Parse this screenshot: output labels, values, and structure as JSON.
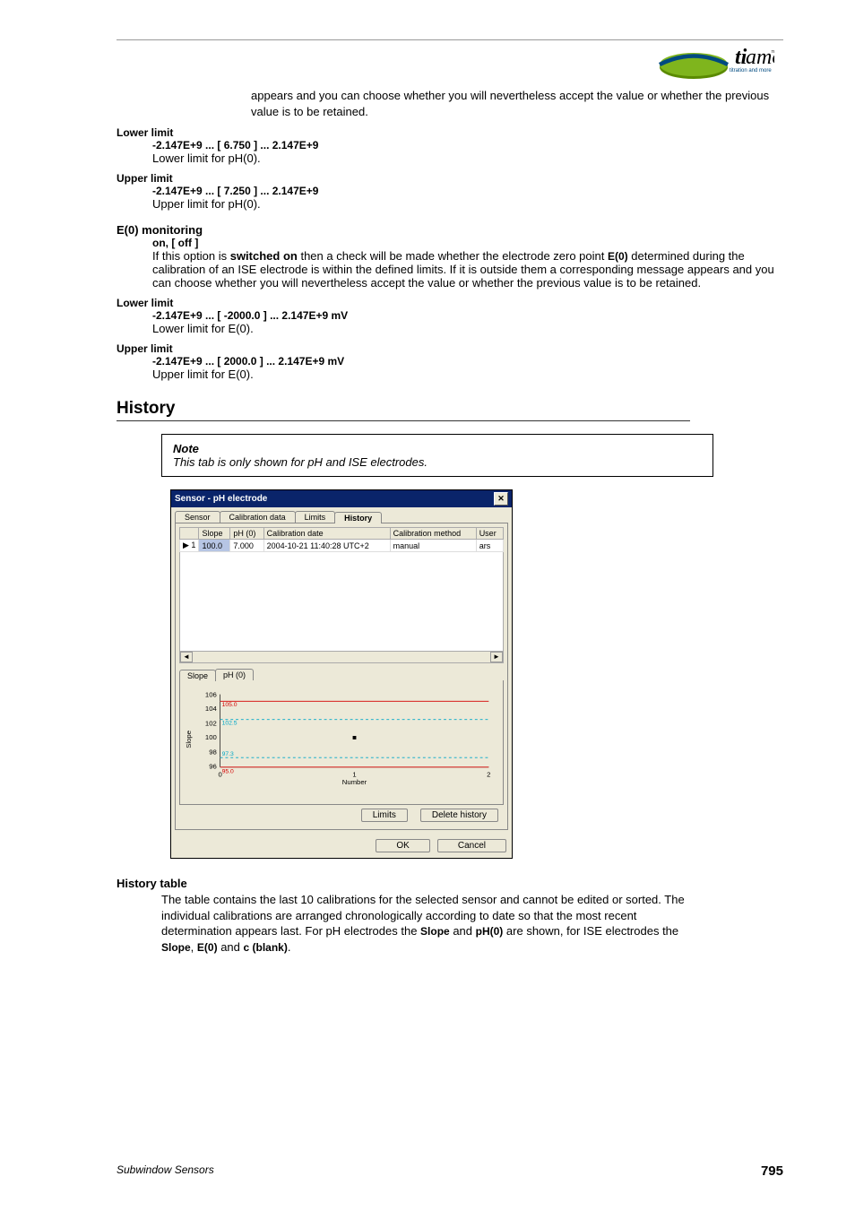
{
  "logo": {
    "brand": "tiamo",
    "tm": "™",
    "tagline": "titration and more"
  },
  "intro_cont": "appears and you can choose whether you will nevertheless accept the value or whether the previous value is to be retained.",
  "ph0": {
    "lower": {
      "label": "Lower limit",
      "range": "-2.147E+9 ... [ 6.750 ] ... 2.147E+9",
      "desc": "Lower limit for pH(0)."
    },
    "upper": {
      "label": "Upper limit",
      "range": "-2.147E+9 ... [ 7.250 ] ... 2.147E+9",
      "desc": "Upper limit for pH(0)."
    }
  },
  "e0": {
    "heading": "E(0) monitoring",
    "options": "on, [ off ]",
    "desc1": "If this option is ",
    "desc_bold": "switched on",
    "desc2": " then a check will be made whether the electrode zero point ",
    "desc_bold2": "E(0)",
    "desc3": " determined during the calibration of an ISE electrode is within the defined limits. If it is outside them a corresponding message appears and you can choose whether you will nevertheless accept the value or whether the previous value is to be retained.",
    "lower": {
      "label": "Lower limit",
      "range": "-2.147E+9 ... [ -2000.0 ] ... 2.147E+9 mV",
      "desc": "Lower limit for E(0)."
    },
    "upper": {
      "label": "Upper limit",
      "range": "-2.147E+9 ... [ 2000.0 ] ... 2.147E+9 mV",
      "desc": "Upper limit for E(0)."
    }
  },
  "history": {
    "heading": "History",
    "note_label": "Note",
    "note_text": "This tab is only shown for pH and ISE electrodes.",
    "table_heading": "History table",
    "para_a": "The table contains the last 10 calibrations for the selected sensor and cannot be edited or sorted. The individual calibrations are arranged chronologically according to date so that the most recent determination appears last. For pH electrodes the ",
    "b1": "Slope",
    "sep1": " and ",
    "b2": "pH(0)",
    "para_b": " are shown, for ISE electrodes the ",
    "b3": "Slope",
    "sep2": ", ",
    "b4": "E(0)",
    "sep3": " and ",
    "b5": "c (blank)",
    "para_c": "."
  },
  "dialog": {
    "title": "Sensor - pH electrode",
    "tabs": [
      "Sensor",
      "Calibration data",
      "Limits",
      "History"
    ],
    "active_tab": "History",
    "cols": [
      "",
      "Slope",
      "pH (0)",
      "Calibration date",
      "Calibration method",
      "User"
    ],
    "row": {
      "idx": "1",
      "slope": "100.0",
      "ph0": "7.000",
      "date": "2004-10-21 11:40:28 UTC+2",
      "method": "manual",
      "user": "ars"
    },
    "subtabs": [
      "Slope",
      "pH (0)"
    ],
    "buttons": {
      "limits": "Limits",
      "delete": "Delete history",
      "ok": "OK",
      "cancel": "Cancel"
    }
  },
  "chart_data": {
    "type": "scatter",
    "title": "",
    "xlabel": "Number",
    "ylabel": "Slope",
    "xlim": [
      0,
      2
    ],
    "ylim": [
      96,
      106
    ],
    "yticks": [
      96,
      98,
      100,
      102,
      104,
      106
    ],
    "xticks": [
      0,
      1,
      2
    ],
    "series": [
      {
        "name": "Slope",
        "x": [
          1
        ],
        "y": [
          100.0
        ]
      }
    ],
    "annotations": [
      {
        "y": 105.0,
        "text": "105.0",
        "style": "solid-red"
      },
      {
        "y": 102.5,
        "text": "102.5",
        "style": "dashed-cyan"
      },
      {
        "y": 97.3,
        "text": "97.3",
        "style": "dashed-cyan"
      },
      {
        "y": 95.0,
        "text": "95.0",
        "style": "solid-red"
      }
    ]
  },
  "footer": {
    "left": "Subwindow Sensors",
    "right": "795"
  }
}
